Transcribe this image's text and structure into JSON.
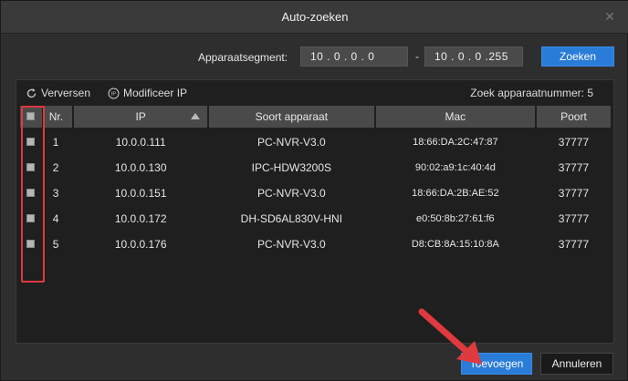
{
  "window": {
    "title": "Auto-zoeken",
    "close_glyph": "✕"
  },
  "segment": {
    "label": "Apparaatsegment:",
    "start_ip": "10 . 0 . 0 . 0",
    "separator": "-",
    "end_ip": "10 . 0 . 0 .255",
    "search_button": "Zoeken"
  },
  "toolbar": {
    "refresh_label": "Verversen",
    "refresh_icon": "refresh-icon",
    "modify_label": "Modificeer IP",
    "modify_icon": "ip-icon",
    "device_count_label": "Zoek apparaatnummer:",
    "device_count": "5"
  },
  "table": {
    "headers": {
      "nr": "Nr.",
      "ip": "IP",
      "type": "Soort apparaat",
      "mac": "Mac",
      "port": "Poort"
    },
    "rows": [
      {
        "nr": "1",
        "ip": "10.0.0.111",
        "type": "PC-NVR-V3.0",
        "mac": "18:66:DA:2C:47:87",
        "port": "37777"
      },
      {
        "nr": "2",
        "ip": "10.0.0.130",
        "type": "IPC-HDW3200S",
        "mac": "90:02:a9:1c:40:4d",
        "port": "37777"
      },
      {
        "nr": "3",
        "ip": "10.0.0.151",
        "type": "PC-NVR-V3.0",
        "mac": "18:66:DA:2B:AE:52",
        "port": "37777"
      },
      {
        "nr": "4",
        "ip": "10.0.0.172",
        "type": "DH-SD6AL830V-HNI",
        "mac": "e0:50:8b:27:61:f6",
        "port": "37777"
      },
      {
        "nr": "5",
        "ip": "10.0.0.176",
        "type": "PC-NVR-V3.0",
        "mac": "D8:CB:8A:15:10:8A",
        "port": "37777"
      }
    ]
  },
  "footer": {
    "add_button": "Toevoegen",
    "cancel_button": "Annuleren"
  },
  "colors": {
    "accent": "#2a7cd9",
    "annotation": "#e0393e"
  }
}
